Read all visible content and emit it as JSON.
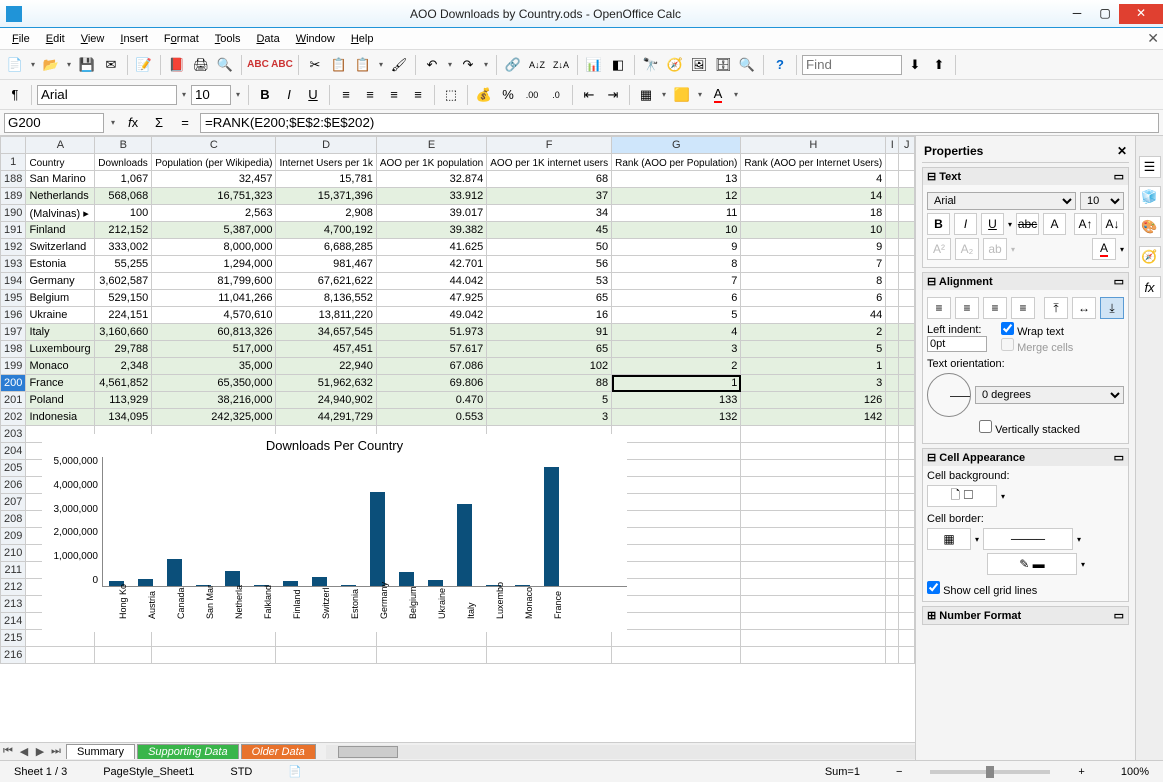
{
  "window": {
    "title": "AOO Downloads by Country.ods - OpenOffice Calc"
  },
  "menus": [
    "File",
    "Edit",
    "View",
    "Insert",
    "Format",
    "Tools",
    "Data",
    "Window",
    "Help"
  ],
  "find_placeholder": "Find",
  "format_toolbar": {
    "font": "Arial",
    "size": "10"
  },
  "formula_bar": {
    "cellref": "G200",
    "formula": "=RANK(E200;$E$2:$E$202)"
  },
  "columns": [
    "A",
    "B",
    "C",
    "D",
    "E",
    "F",
    "G",
    "H",
    "I",
    "J"
  ],
  "header_row": {
    "num": "1",
    "cells": [
      "Country",
      "Downloads",
      "Population (per Wikipedia)",
      "Internet Users per 1k",
      "AOO per 1K population",
      "AOO per 1K internet users",
      "Rank (AOO per Population)",
      "Rank (AOO per Internet Users)",
      "",
      ""
    ]
  },
  "rows": [
    {
      "n": 188,
      "g": false,
      "c": [
        "San Marino",
        "1,067",
        "32,457",
        "15,781",
        "32.874",
        "68",
        "13",
        "4"
      ]
    },
    {
      "n": 189,
      "g": true,
      "c": [
        "Netherlands",
        "568,068",
        "16,751,323",
        "15,371,396",
        "33.912",
        "37",
        "12",
        "14"
      ]
    },
    {
      "n": 190,
      "g": false,
      "c": [
        "(Malvinas)",
        "100",
        "2,563",
        "2,908",
        "39.017",
        "34",
        "11",
        "18"
      ],
      "arrow": true
    },
    {
      "n": 191,
      "g": true,
      "c": [
        "Finland",
        "212,152",
        "5,387,000",
        "4,700,192",
        "39.382",
        "45",
        "10",
        "10"
      ]
    },
    {
      "n": 192,
      "g": false,
      "c": [
        "Switzerland",
        "333,002",
        "8,000,000",
        "6,688,285",
        "41.625",
        "50",
        "9",
        "9"
      ]
    },
    {
      "n": 193,
      "g": false,
      "c": [
        "Estonia",
        "55,255",
        "1,294,000",
        "981,467",
        "42.701",
        "56",
        "8",
        "7"
      ]
    },
    {
      "n": 194,
      "g": false,
      "c": [
        "Germany",
        "3,602,587",
        "81,799,600",
        "67,621,622",
        "44.042",
        "53",
        "7",
        "8"
      ]
    },
    {
      "n": 195,
      "g": false,
      "c": [
        "Belgium",
        "529,150",
        "11,041,266",
        "8,136,552",
        "47.925",
        "65",
        "6",
        "6"
      ]
    },
    {
      "n": 196,
      "g": false,
      "c": [
        "Ukraine",
        "224,151",
        "4,570,610",
        "13,811,220",
        "49.042",
        "16",
        "5",
        "44"
      ]
    },
    {
      "n": 197,
      "g": true,
      "c": [
        "Italy",
        "3,160,660",
        "60,813,326",
        "34,657,545",
        "51.973",
        "91",
        "4",
        "2"
      ]
    },
    {
      "n": 198,
      "g": true,
      "c": [
        "Luxembourg",
        "29,788",
        "517,000",
        "457,451",
        "57.617",
        "65",
        "3",
        "5"
      ]
    },
    {
      "n": 199,
      "g": true,
      "c": [
        "Monaco",
        "2,348",
        "35,000",
        "22,940",
        "67.086",
        "102",
        "2",
        "1"
      ]
    },
    {
      "n": 200,
      "g": true,
      "c": [
        "France",
        "4,561,852",
        "65,350,000",
        "51,962,632",
        "69.806",
        "88",
        "1",
        "3"
      ],
      "sel": true
    },
    {
      "n": 201,
      "g": true,
      "c": [
        "Poland",
        "113,929",
        "38,216,000",
        "24,940,902",
        "0.470",
        "5",
        "133",
        "126"
      ]
    },
    {
      "n": 202,
      "g": true,
      "c": [
        "Indonesia",
        "134,095",
        "242,325,000",
        "44,291,729",
        "0.553",
        "3",
        "132",
        "142"
      ]
    },
    {
      "n": 203,
      "g": false,
      "c": [
        "",
        "",
        "",
        "",
        "",
        "",
        "",
        ""
      ]
    },
    {
      "n": 204,
      "g": false,
      "c": [
        "",
        "",
        "",
        "",
        "",
        "",
        "",
        ""
      ]
    },
    {
      "n": 205,
      "g": false,
      "c": [
        "",
        "",
        "",
        "",
        "",
        "",
        "",
        ""
      ]
    },
    {
      "n": 206,
      "g": false,
      "c": [
        "",
        "",
        "",
        "",
        "",
        "",
        "",
        ""
      ]
    },
    {
      "n": 207,
      "g": false,
      "c": [
        "",
        "",
        "",
        "",
        "",
        "",
        "",
        ""
      ]
    },
    {
      "n": 208,
      "g": false,
      "c": [
        "",
        "",
        "",
        "",
        "",
        "",
        "",
        ""
      ]
    },
    {
      "n": 209,
      "g": false,
      "c": [
        "",
        "",
        "",
        "",
        "",
        "",
        "",
        ""
      ]
    },
    {
      "n": 210,
      "g": false,
      "c": [
        "",
        "",
        "",
        "",
        "",
        "",
        "",
        ""
      ]
    },
    {
      "n": 211,
      "g": false,
      "c": [
        "",
        "",
        "",
        "",
        "",
        "",
        "",
        ""
      ]
    },
    {
      "n": 212,
      "g": false,
      "c": [
        "",
        "",
        "",
        "",
        "",
        "",
        "",
        ""
      ]
    },
    {
      "n": 213,
      "g": false,
      "c": [
        "",
        "",
        "",
        "",
        "",
        "",
        "",
        ""
      ]
    },
    {
      "n": 214,
      "g": false,
      "c": [
        "",
        "",
        "",
        "",
        "",
        "",
        "",
        ""
      ]
    },
    {
      "n": 215,
      "g": false,
      "c": [
        "",
        "",
        "",
        "",
        "",
        "",
        "",
        ""
      ]
    },
    {
      "n": 216,
      "g": false,
      "c": [
        "",
        "",
        "",
        "",
        "",
        "",
        "",
        ""
      ]
    }
  ],
  "chart_data": {
    "type": "bar",
    "title": "Downloads Per Country",
    "categories": [
      "Hong Ko",
      "Austria",
      "Canada",
      "San Mar",
      "Netherla",
      "Falkland",
      "Finland",
      "Switzerl",
      "Estonia",
      "Germany",
      "Belgium",
      "Ukraine",
      "Italy",
      "Luxembo",
      "Monaco",
      "France"
    ],
    "values": [
      200000,
      280000,
      1050000,
      1000,
      568000,
      100,
      212000,
      333000,
      55000,
      3602000,
      529000,
      224000,
      3160000,
      30000,
      2300,
      4561000
    ],
    "ylabels": [
      "5,000,000",
      "4,000,000",
      "3,000,000",
      "2,000,000",
      "1,000,000",
      "0"
    ],
    "ymax": 5000000
  },
  "sheet_tabs": {
    "summary": "Summary",
    "supporting": "Supporting Data",
    "older": "Older Data"
  },
  "properties": {
    "title": "Properties",
    "text": {
      "title": "Text",
      "font": "Arial",
      "size": "10",
      "left_indent_label": "Left indent:",
      "left_indent_value": "0pt",
      "wrap_text": "Wrap text",
      "merge_cells": "Merge cells",
      "orientation_label": "Text orientation:",
      "degrees": "0 degrees",
      "vstacked": "Vertically stacked",
      "alignment_title": "Alignment"
    },
    "cell": {
      "title": "Cell Appearance",
      "bg_label": "Cell background:",
      "border_label": "Cell border:",
      "gridlines": "Show cell grid lines"
    },
    "numfmt": {
      "title": "Number Format"
    }
  },
  "statusbar": {
    "sheet": "Sheet 1 / 3",
    "style": "PageStyle_Sheet1",
    "mode": "STD",
    "sum": "Sum=1",
    "zoom": "100%"
  }
}
